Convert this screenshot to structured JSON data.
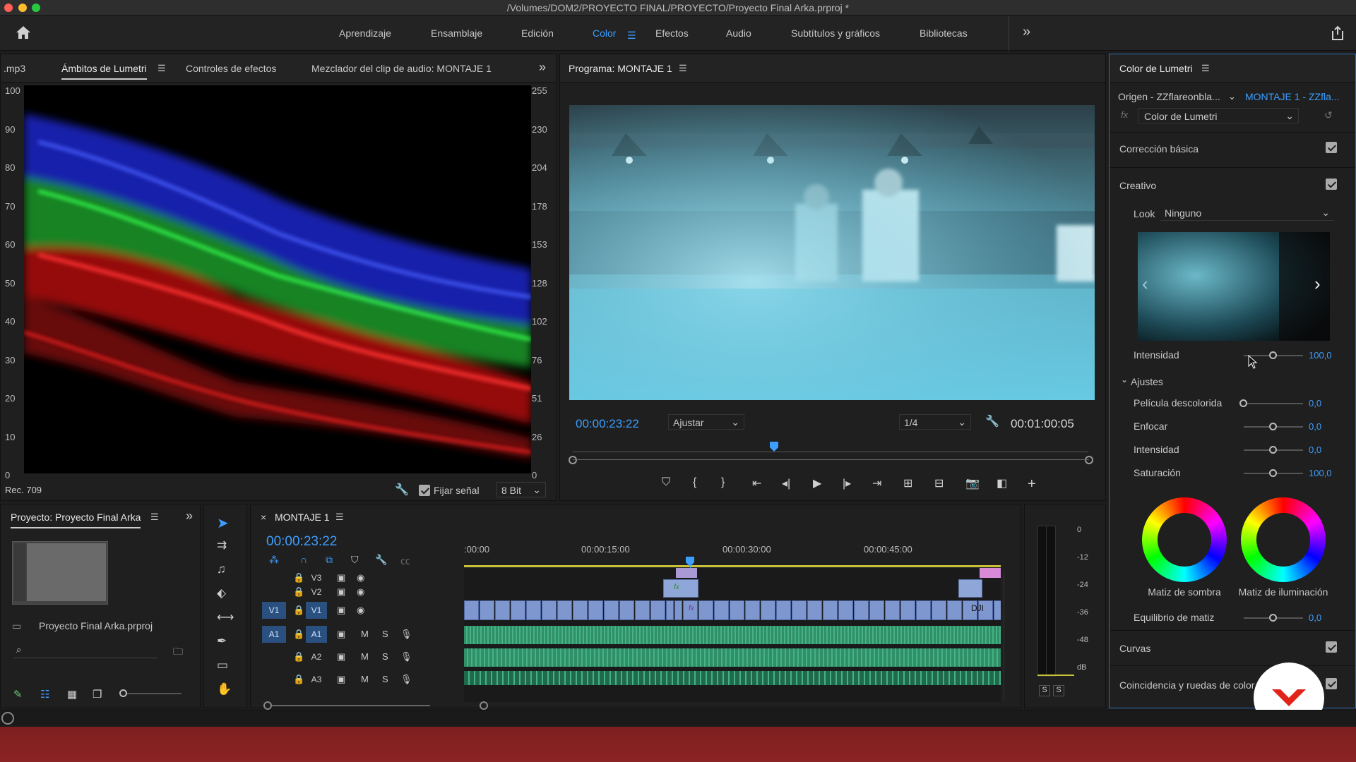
{
  "window": {
    "title": "/Volumes/DOM2/PROYECTO FINAL/PROYECTO/Proyecto Final Arka.prproj *"
  },
  "workspaces": [
    "Aprendizaje",
    "Ensamblaje",
    "Edición",
    "Color",
    "Efectos",
    "Audio",
    "Subtítulos y gráficos",
    "Bibliotecas"
  ],
  "active_workspace": "Color",
  "scopes_panel": {
    "tabs": [
      ".mp3",
      "Ámbitos de Lumetri",
      "Controles de efectos",
      "Mezclador del clip de audio: MONTAJE 1"
    ],
    "left_scale": [
      "100",
      "90",
      "80",
      "70",
      "60",
      "50",
      "40",
      "30",
      "20",
      "10",
      "0"
    ],
    "right_scale": [
      "255",
      "230",
      "204",
      "178",
      "153",
      "128",
      "102",
      "76",
      "51",
      "26",
      "0"
    ],
    "colorspace": "Rec. 709",
    "fix_signal_label": "Fijar señal",
    "bit_depth": "8 Bit"
  },
  "program_monitor": {
    "title": "Programa: MONTAJE 1",
    "timecode": "00:00:23:22",
    "fit": "Ajustar",
    "resolution": "1/4",
    "duration": "00:01:00:05",
    "playhead_fraction": 0.39
  },
  "project_panel": {
    "title": "Proyecto: Proyecto Final Arka",
    "file": "Proyecto Final Arka.prproj"
  },
  "timeline": {
    "sequence": "MONTAJE 1",
    "timecode": "00:00:23:22",
    "ruler": [
      ":00:00",
      "00:00:15:00",
      "00:00:30:00",
      "00:00:45:00"
    ],
    "tracks": [
      {
        "id": "V3",
        "controls": "icons"
      },
      {
        "id": "V2"
      },
      {
        "id": "V1",
        "source": "V1"
      },
      {
        "id": "A1",
        "source": "A1",
        "m": "M",
        "s": "S"
      },
      {
        "id": "A2",
        "m": "M",
        "s": "S"
      },
      {
        "id": "A3",
        "m": "M",
        "s": "S"
      }
    ],
    "clip_label": "DJI",
    "fx": "fx"
  },
  "audio_meter": {
    "scale": [
      "0",
      "-12",
      "-24",
      "-36",
      "-48",
      "dB"
    ],
    "solo": [
      "S",
      "S"
    ]
  },
  "lumetri": {
    "title": "Color de Lumetri",
    "source": "Origen - ZZflareonbla...",
    "target": "MONTAJE 1 - ZZfla...",
    "effect": "Color de Lumetri",
    "sections": {
      "basic": "Corrección básica",
      "creative": "Creativo",
      "curves": "Curvas",
      "match": "Coincidencia y ruedas de color"
    },
    "look_label": "Look",
    "look_value": "Ninguno",
    "intensity_label": "Intensidad",
    "intensity_value": "100,0",
    "adjustments_label": "Ajustes",
    "adjustments": [
      {
        "label": "Película descolorida",
        "value": "0,0",
        "level": 0.0
      },
      {
        "label": "Enfocar",
        "value": "0,0",
        "level": 0.5
      },
      {
        "label": "Intensidad",
        "value": "0,0",
        "level": 0.5
      },
      {
        "label": "Saturación",
        "value": "100,0",
        "level": 0.5
      }
    ],
    "wheels": [
      "Matiz de sombra",
      "Matiz de iluminación"
    ],
    "balance_label": "Equilibrio de matiz",
    "balance_value": "0,0"
  }
}
